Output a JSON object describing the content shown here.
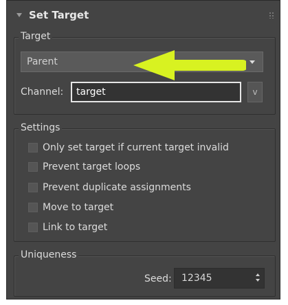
{
  "rollout": {
    "title": "Set Target"
  },
  "target_group": {
    "title": "Target",
    "dropdown": {
      "selected": "Parent"
    },
    "channel_label": "Channel:",
    "channel_value": "target",
    "v_button_label": "v"
  },
  "settings_group": {
    "title": "Settings",
    "options": [
      {
        "label": "Only set target if current target invalid",
        "checked": false
      },
      {
        "label": "Prevent target loops",
        "checked": false
      },
      {
        "label": "Prevent duplicate assignments",
        "checked": false
      },
      {
        "label": "Move to target",
        "checked": false
      },
      {
        "label": "Link to target",
        "checked": false
      }
    ]
  },
  "uniqueness_group": {
    "title": "Uniqueness",
    "seed_label": "Seed:",
    "seed_value": "12345"
  },
  "colors": {
    "panel_bg": "#444444",
    "annotation_arrow": "#d8f221"
  }
}
